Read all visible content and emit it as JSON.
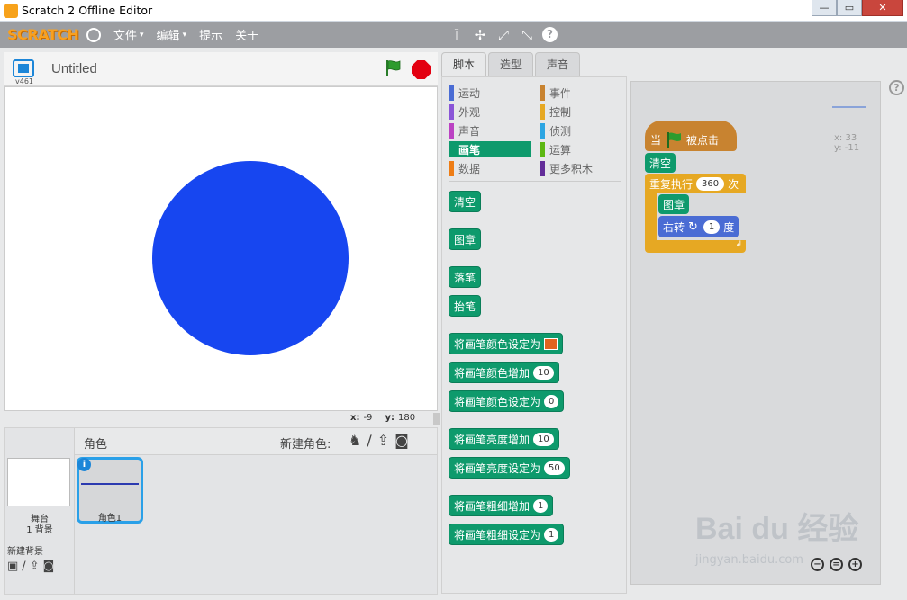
{
  "window": {
    "title": "Scratch 2 Offline Editor",
    "minimize": "—",
    "maximize": "▭",
    "close": "✕"
  },
  "menubar": {
    "logo": "SCRATCH",
    "menus": [
      "文件",
      "编辑",
      "提示",
      "关于"
    ],
    "menu_caret": "▾",
    "tool_icons": [
      "duplicate-icon",
      "cut-icon",
      "grow-icon",
      "shrink-icon",
      "help-icon"
    ],
    "tool_glyphs": [
      "⍑",
      "✢",
      "⤢",
      "⤡",
      "?"
    ]
  },
  "stage": {
    "version": "v461",
    "project_title": "Untitled",
    "pen_color": "#1746f0",
    "mouse_x_label": "x:",
    "mouse_x": "-9",
    "mouse_y_label": "y:",
    "mouse_y": "180"
  },
  "sprites_pane": {
    "stage_label": "舞台",
    "backdrop_count": "1 背景",
    "new_backdrop": "新建背景",
    "header_label": "角色",
    "new_sprite": "新建角色:",
    "sprite_name": "角色1",
    "info": "i"
  },
  "tabs": [
    "脚本",
    "造型",
    "声音"
  ],
  "categories": [
    {
      "label": "运动",
      "color": "#4a6cd4"
    },
    {
      "label": "事件",
      "color": "#c88330"
    },
    {
      "label": "外观",
      "color": "#8a55d7"
    },
    {
      "label": "控制",
      "color": "#e6a823"
    },
    {
      "label": "声音",
      "color": "#bb42c3"
    },
    {
      "label": "侦测",
      "color": "#2ca5e2"
    },
    {
      "label": "画笔",
      "color": "#0e9a6c"
    },
    {
      "label": "运算",
      "color": "#5cb712"
    },
    {
      "label": "数据",
      "color": "#ee7d16"
    },
    {
      "label": "更多积木",
      "color": "#632d99"
    }
  ],
  "palette_blocks": [
    {
      "label": "清空"
    },
    {
      "label": "图章"
    },
    {
      "label": "落笔"
    },
    {
      "label": "抬笔"
    },
    {
      "label": "将画笔颜色设定为",
      "slot_type": "color"
    },
    {
      "label": "将画笔颜色增加",
      "slot": "10"
    },
    {
      "label": "将画笔颜色设定为",
      "slot": "0"
    },
    {
      "label": "将画笔亮度增加",
      "slot": "10"
    },
    {
      "label": "将画笔亮度设定为",
      "slot": "50"
    },
    {
      "label": "将画笔粗细增加",
      "slot": "1"
    },
    {
      "label": "将画笔粗细设定为",
      "slot": "1"
    }
  ],
  "script": {
    "hat_when": "当",
    "hat_clicked": "被点击",
    "clear": "清空",
    "repeat_label": "重复执行",
    "repeat_count": "360",
    "repeat_unit": "次",
    "stamp": "图章",
    "turn_label": "右转",
    "turn_value": "1",
    "turn_unit": "度",
    "sprite_x": "x: 33",
    "sprite_y": "y: -11"
  },
  "zoom": [
    "−",
    "=",
    "+"
  ],
  "watermark": {
    "brand": "Bai du 经验",
    "url": "jingyan.baidu.com"
  }
}
